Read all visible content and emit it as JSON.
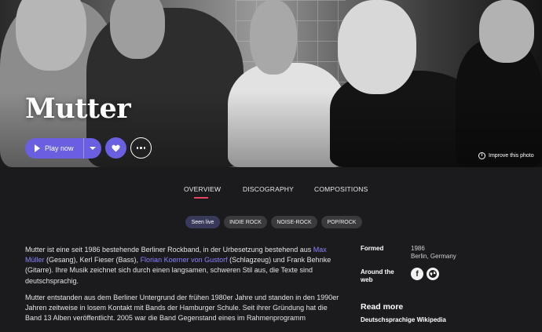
{
  "artist": {
    "name": "Mutter"
  },
  "actions": {
    "play_label": "Play now",
    "improve_label": "Improve this photo"
  },
  "tabs": [
    {
      "label": "OVERVIEW",
      "active": true
    },
    {
      "label": "DISCOGRAPHY",
      "active": false
    },
    {
      "label": "COMPOSITIONS",
      "active": false
    }
  ],
  "genres": [
    {
      "label": "Seen live",
      "active": true
    },
    {
      "label": "INDIE ROCK",
      "active": false
    },
    {
      "label": "NOISE-ROCK",
      "active": false
    },
    {
      "label": "POP/ROCK",
      "active": false
    }
  ],
  "bio": {
    "p1_a": "Mutter ist eine seit 1986 bestehende Berliner Rockband, in der Urbesetzung bestehend aus ",
    "p1_link1": "Max Müller",
    "p1_b": " (Gesang), Kerl Fieser (Bass), ",
    "p1_link2": "Florian Koerner von Gustorf",
    "p1_c": " (Schlagzeug) und Frank Behnke (Gitarre). Ihre Musik zeichnet sich durch einen langsamen, schweren Stil aus, die Texte sind deutschsprachig.",
    "p2": "Mutter entstanden aus dem Berliner Untergrund der frühen 1980er Jahre und standen in den 1990er Jahren zeitweise in losem Kontakt mit Bands der Hamburger Schule. Seit ihrer Gründung hat die Band 13 Alben veröffentlicht. 2005 war die Band Gegenstand eines im Rahmenprogramm"
  },
  "facts": {
    "formed_label": "Formed",
    "formed_year": "1986",
    "formed_place": "Berlin, Germany",
    "web_label": "Around the web",
    "web_icons": [
      "facebook-icon",
      "globe-icon"
    ],
    "read_more": "Read more",
    "wiki_link": "Deutschsprachige Wikipedia"
  },
  "colors": {
    "accent": "#6a5fe0",
    "tab_underline": "#e8435f",
    "link": "#8a83ff",
    "background": "#1b1b1e"
  }
}
